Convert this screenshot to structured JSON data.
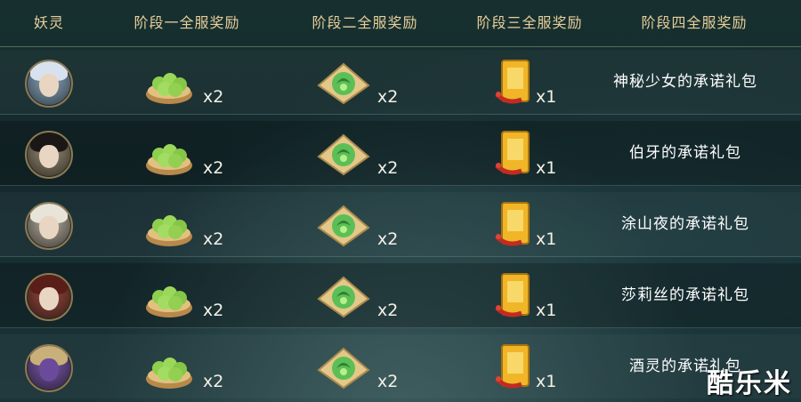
{
  "header": {
    "col0": "妖灵",
    "col1": "阶段一全服奖励",
    "col2": "阶段二全服奖励",
    "col3": "阶段三全服奖励",
    "col4": "阶段四全服奖励"
  },
  "rows": [
    {
      "avatar": "avatar-silver-hair-girl",
      "qty1": "x2",
      "qty2": "x2",
      "qty3": "x1",
      "pack": "神秘少女的承诺礼包"
    },
    {
      "avatar": "avatar-black-hair-man",
      "qty1": "x2",
      "qty2": "x2",
      "qty3": "x1",
      "pack": "伯牙的承诺礼包"
    },
    {
      "avatar": "avatar-white-hair-man",
      "qty1": "x2",
      "qty2": "x2",
      "qty3": "x1",
      "pack": "涂山夜的承诺礼包"
    },
    {
      "avatar": "avatar-red-headdress-girl",
      "qty1": "x2",
      "qty2": "x2",
      "qty3": "x1",
      "pack": "莎莉丝的承诺礼包"
    },
    {
      "avatar": "avatar-purple-wine-jar",
      "qty1": "x2",
      "qty2": "x2",
      "qty3": "x1",
      "pack": "酒灵的承诺礼包"
    }
  ],
  "icons": {
    "col1": "green-dumpling-basket-icon",
    "col2": "jade-crescent-leaf-icon",
    "col3": "golden-command-token-icon"
  },
  "colors": {
    "header_text": "#e6cf9a",
    "body_text": "#ffffff",
    "background": "#14292d"
  },
  "watermark": "酷乐米"
}
